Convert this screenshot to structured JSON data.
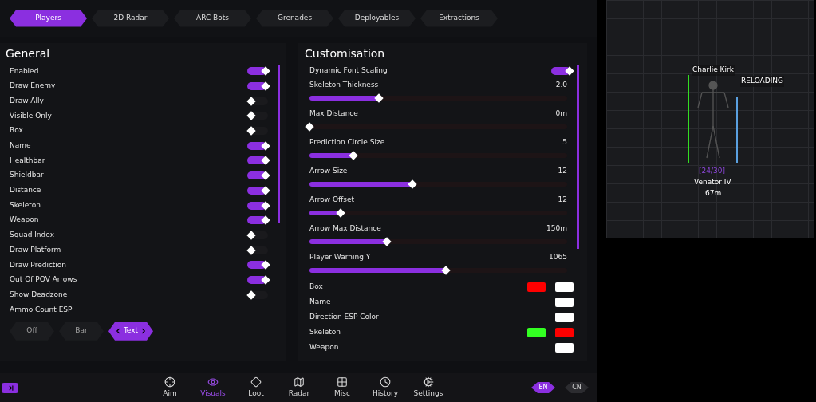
{
  "tabs": [
    {
      "label": "Players",
      "selected": true
    },
    {
      "label": "2D Radar",
      "selected": false
    },
    {
      "label": "ARC Bots",
      "selected": false
    },
    {
      "label": "Grenades",
      "selected": false
    },
    {
      "label": "Deployables",
      "selected": false
    },
    {
      "label": "Extractions",
      "selected": false
    }
  ],
  "general": {
    "title": "General",
    "toggles": [
      {
        "label": "Enabled",
        "on": true
      },
      {
        "label": "Draw Enemy",
        "on": true
      },
      {
        "label": "Draw Ally",
        "on": false
      },
      {
        "label": "Visible Only",
        "on": false
      },
      {
        "label": "Box",
        "on": false
      },
      {
        "label": "Name",
        "on": true
      },
      {
        "label": "Healthbar",
        "on": true
      },
      {
        "label": "Shieldbar",
        "on": true
      },
      {
        "label": "Distance",
        "on": true
      },
      {
        "label": "Skeleton",
        "on": true
      },
      {
        "label": "Weapon",
        "on": true
      },
      {
        "label": "Squad Index",
        "on": false
      },
      {
        "label": "Draw Platform",
        "on": false
      },
      {
        "label": "Draw Prediction",
        "on": true
      },
      {
        "label": "Out Of POV Arrows",
        "on": true
      },
      {
        "label": "Show Deadzone",
        "on": false
      }
    ],
    "ammo": {
      "label": "Ammo Count ESP",
      "options": [
        {
          "label": "Off",
          "selected": false
        },
        {
          "label": "Bar",
          "selected": false
        },
        {
          "label": "Text",
          "selected": true
        }
      ]
    }
  },
  "customisation": {
    "title": "Customisation",
    "rows": [
      {
        "kind": "toggle",
        "label": "Dynamic Font Scaling",
        "on": true
      },
      {
        "kind": "slider",
        "label": "Skeleton Thickness",
        "reading": "2.0",
        "level": 0.27
      },
      {
        "kind": "slider",
        "label": "Max Distance",
        "reading": "0m",
        "level": 0
      },
      {
        "kind": "slider",
        "label": "Prediction Circle Size",
        "reading": "5",
        "level": 0.17
      },
      {
        "kind": "slider",
        "label": "Arrow Size",
        "reading": "12",
        "level": 0.4
      },
      {
        "kind": "slider",
        "label": "Arrow Offset",
        "reading": "12",
        "level": 0.12
      },
      {
        "kind": "slider",
        "label": "Arrow Max Distance",
        "reading": "150m",
        "level": 0.3
      },
      {
        "kind": "slider",
        "label": "Player Warning Y",
        "reading": "1065",
        "level": 0.53
      },
      {
        "kind": "colors",
        "label": "Box",
        "swatches": [
          {
            "color": "#ff0000"
          },
          {
            "color": "#ffffff"
          }
        ]
      },
      {
        "kind": "colors",
        "label": "Name",
        "swatches": [
          {
            "color": "#ffffff"
          }
        ]
      },
      {
        "kind": "colors",
        "label": "Direction ESP Color",
        "swatches": [
          {
            "color": "#ffffff"
          }
        ]
      },
      {
        "kind": "colors",
        "label": "Skeleton",
        "swatches": [
          {
            "color": "#33ff22"
          },
          {
            "color": "#ff0000"
          }
        ]
      },
      {
        "kind": "colors",
        "label": "Weapon",
        "swatches": [
          {
            "color": "#ffffff"
          }
        ]
      }
    ]
  },
  "nav": [
    {
      "kind": "aim",
      "label": "Aim",
      "selected": false
    },
    {
      "kind": "visuals",
      "label": "Visuals",
      "selected": true
    },
    {
      "kind": "loot",
      "label": "Loot",
      "selected": false
    },
    {
      "kind": "radar",
      "label": "Radar",
      "selected": false
    },
    {
      "kind": "misc",
      "label": "Misc",
      "selected": false
    },
    {
      "kind": "history",
      "label": "History",
      "selected": false
    },
    {
      "kind": "settings",
      "label": "Settings",
      "selected": false
    }
  ],
  "languages": [
    {
      "label": "EN",
      "selected": true
    },
    {
      "label": "CN",
      "selected": false
    }
  ],
  "preview": {
    "name": "Charlie Kirk",
    "status": "RELOADING",
    "ammo": "[24/30]",
    "weapon": "Venator IV",
    "distance": "67m"
  }
}
